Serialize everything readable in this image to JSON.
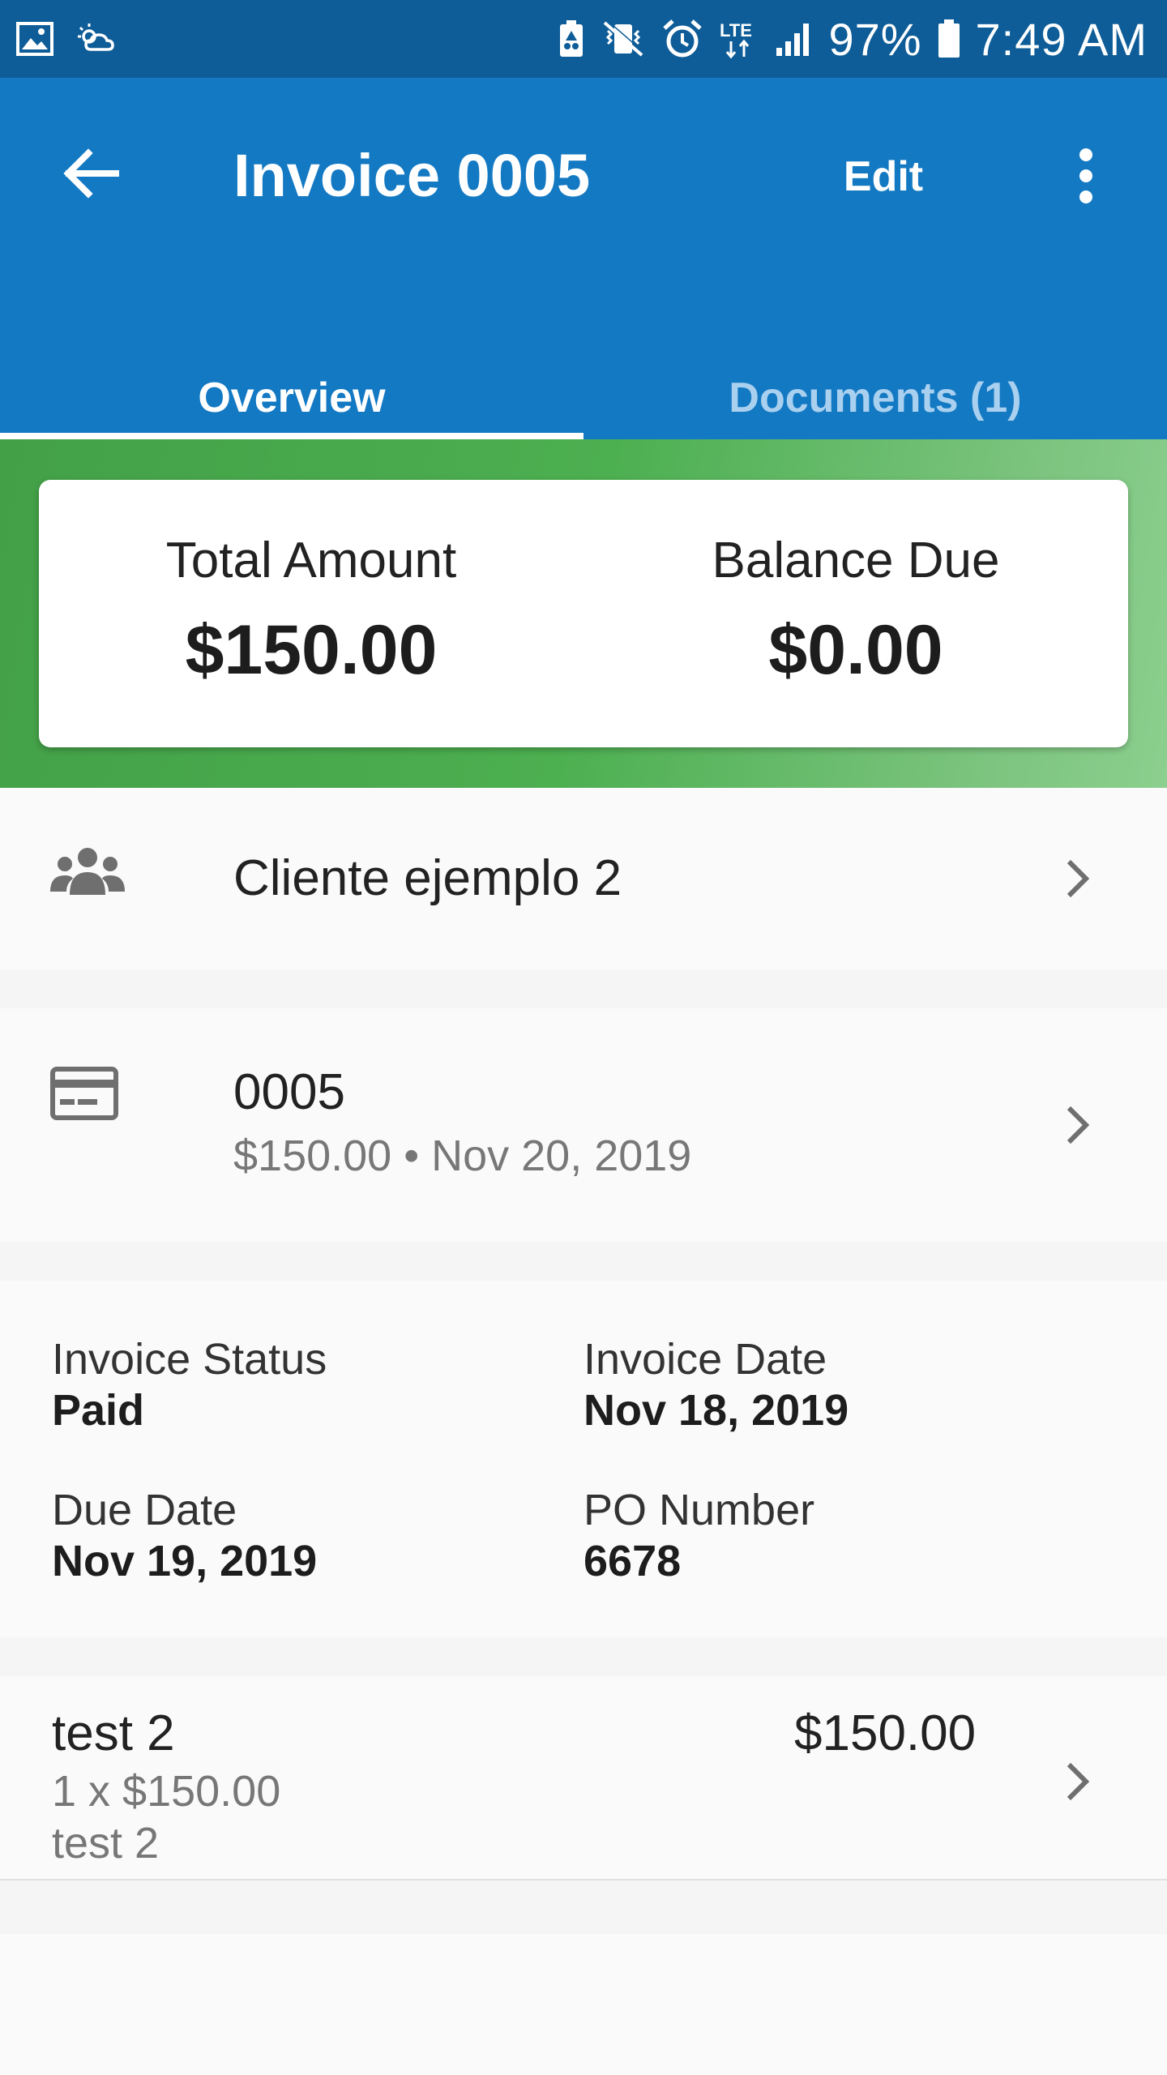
{
  "status_bar": {
    "battery": "97%",
    "time": "7:49 AM",
    "network": "LTE",
    "icons": [
      "image-icon",
      "weather-icon",
      "battery-saver-icon",
      "vibrate-mute-icon",
      "alarm-icon",
      "lte-icon",
      "signal-icon",
      "battery-icon"
    ]
  },
  "app_bar": {
    "title": "Invoice 0005",
    "edit_label": "Edit",
    "back_icon": "arrow-back-icon",
    "more_icon": "more-vert-icon",
    "tabs": [
      {
        "label": "Overview",
        "active": true
      },
      {
        "label": "Documents (1)",
        "active": false
      }
    ]
  },
  "summary": {
    "total_label": "Total Amount",
    "total_value": "$150.00",
    "balance_label": "Balance Due",
    "balance_value": "$0.00"
  },
  "client": {
    "icon": "people-icon",
    "name": "Cliente ejemplo 2"
  },
  "payment": {
    "icon": "credit-card-icon",
    "number": "0005",
    "subtitle": "$150.00 • Nov 20, 2019"
  },
  "details": {
    "status_label": "Invoice Status",
    "status_value": "Paid",
    "invoice_date_label": "Invoice Date",
    "invoice_date_value": "Nov 18, 2019",
    "due_date_label": "Due Date",
    "due_date_value": "Nov 19, 2019",
    "po_label": "PO Number",
    "po_value": "6678"
  },
  "line_item": {
    "name": "test 2",
    "price": "$150.00",
    "quantity": "1 x $150.00",
    "description": "test 2"
  },
  "colors": {
    "status_bar": "#0e5d98",
    "app_bar": "#1379c3",
    "tab_inactive": "#a9d0ee",
    "summary_green": "#4caf50"
  }
}
